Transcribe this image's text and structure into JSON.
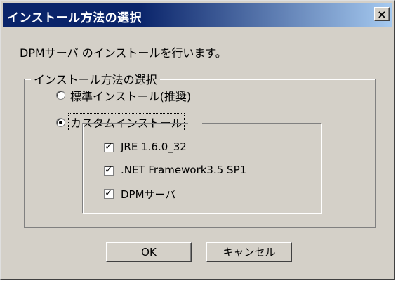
{
  "window": {
    "title": "インストール方法の選択",
    "close_symbol": "×"
  },
  "description": "DPMサーバ のインストールを行います。",
  "group": {
    "label": "インストール方法の選択",
    "options": [
      {
        "label": "標準インストール(推奨)",
        "selected": false
      },
      {
        "label": "カスタムインストール",
        "selected": true
      }
    ]
  },
  "custom": {
    "components": [
      {
        "label": "JRE 1.6.0_32",
        "checked": true
      },
      {
        "label": ".NET Framework3.5 SP1",
        "checked": true
      },
      {
        "label": "DPMサーバ",
        "checked": true
      }
    ]
  },
  "buttons": {
    "ok": "OK",
    "cancel": "キャンセル"
  },
  "check_symbol": "✓"
}
